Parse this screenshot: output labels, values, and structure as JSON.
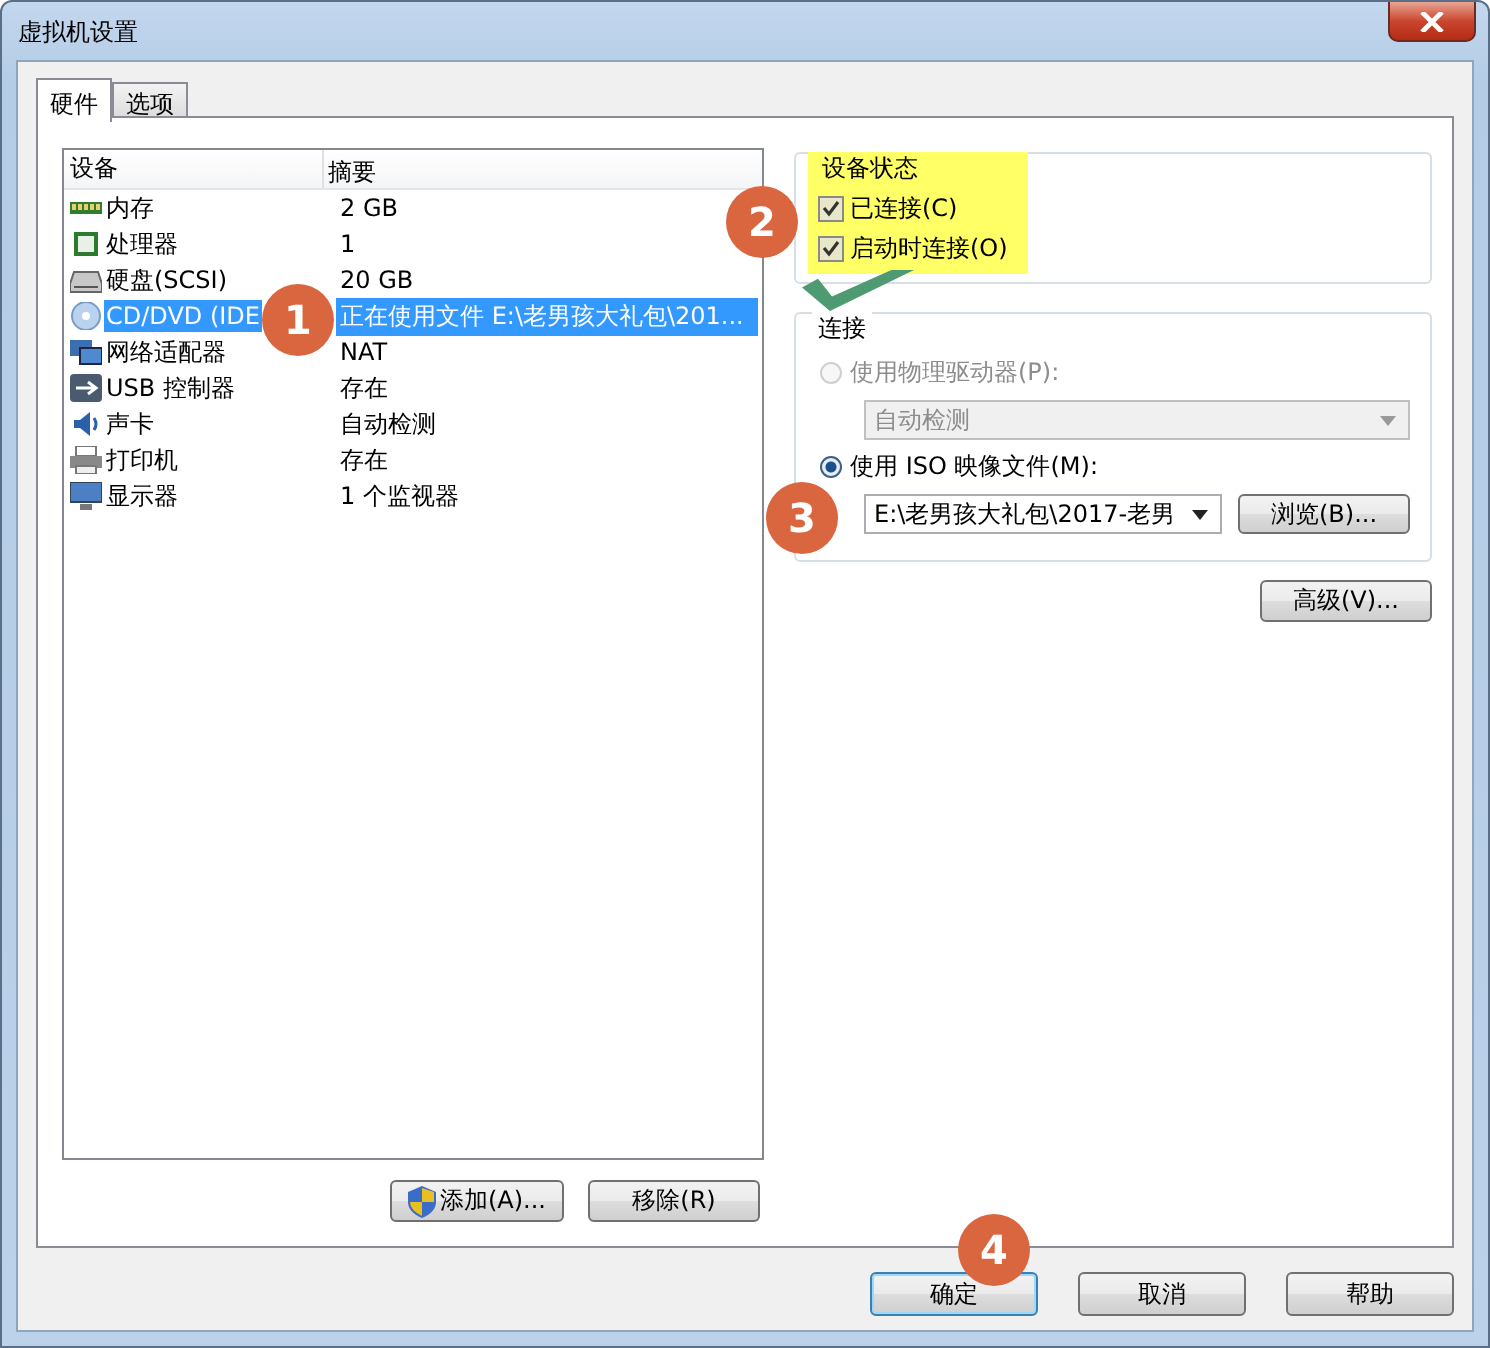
{
  "window": {
    "title": "虚拟机设置"
  },
  "tabs": [
    {
      "label": "硬件",
      "selected": true
    },
    {
      "label": "选项",
      "selected": false
    }
  ],
  "devices": {
    "columns": [
      "设备",
      "摘要"
    ],
    "rows": [
      {
        "device": "内存",
        "summary": "2 GB",
        "selected": false
      },
      {
        "device": "处理器",
        "summary": "1",
        "selected": false
      },
      {
        "device": "硬盘(SCSI)",
        "summary": "20 GB",
        "selected": false
      },
      {
        "device": "CD/DVD (IDE",
        "summary": "正在使用文件 E:\\老男孩大礼包\\201...",
        "selected": true
      },
      {
        "device": "网络适配器",
        "summary": "NAT",
        "selected": false
      },
      {
        "device": "USB 控制器",
        "summary": "存在",
        "selected": false
      },
      {
        "device": "声卡",
        "summary": "自动检测",
        "selected": false
      },
      {
        "device": "打印机",
        "summary": "存在",
        "selected": false
      },
      {
        "device": "显示器",
        "summary": "1 个监视器",
        "selected": false
      }
    ]
  },
  "device_buttons": [
    "添加(A)...",
    "移除(R)"
  ],
  "device_status": {
    "title": "设备状态",
    "options": [
      {
        "label": "已连接(C)",
        "checked": true
      },
      {
        "label": "启动时连接(O)",
        "checked": true
      }
    ]
  },
  "connection": {
    "title": "连接",
    "choices": [
      {
        "label": "使用物理驱动器(P):",
        "selected": false,
        "disabled": true,
        "combo": "自动检测"
      },
      {
        "label": "使用 ISO 映像文件(M):",
        "selected": true,
        "disabled": false,
        "combo": "E:\\老男孩大礼包\\2017-老男",
        "button": "浏览(B)..."
      }
    ]
  },
  "advanced_button": "高级(V)...",
  "dialog_buttons": [
    {
      "label": "确定",
      "default": true
    },
    {
      "label": "取消",
      "default": false
    },
    {
      "label": "帮助",
      "default": false
    }
  ],
  "annotations": [
    "1",
    "2",
    "3",
    "4"
  ]
}
